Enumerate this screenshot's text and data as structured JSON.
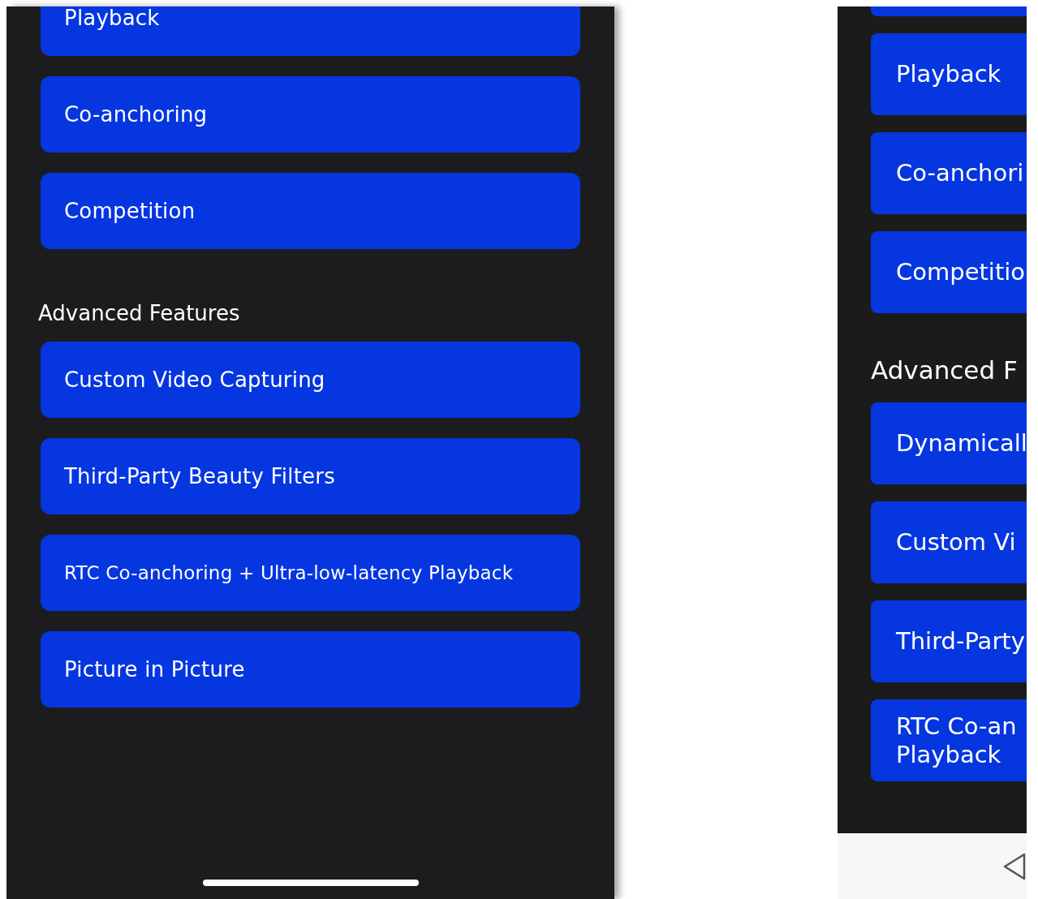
{
  "left_screen": {
    "top_items": [
      "Playback",
      "Co-anchoring",
      "Competition"
    ],
    "section_title": "Advanced Features",
    "advanced_items": [
      "Custom Video Capturing",
      "Third-Party Beauty Filters",
      "RTC Co-anchoring + Ultra-low-latency Playback",
      "Picture in Picture"
    ]
  },
  "right_screen": {
    "top_items": [
      "Playback",
      "Co-anchori",
      "Competitio"
    ],
    "section_title": "Advanced F",
    "advanced_items": [
      "Dynamicall",
      "Custom Vi",
      "Third-Party",
      "RTC Co-an\nPlayback"
    ]
  }
}
